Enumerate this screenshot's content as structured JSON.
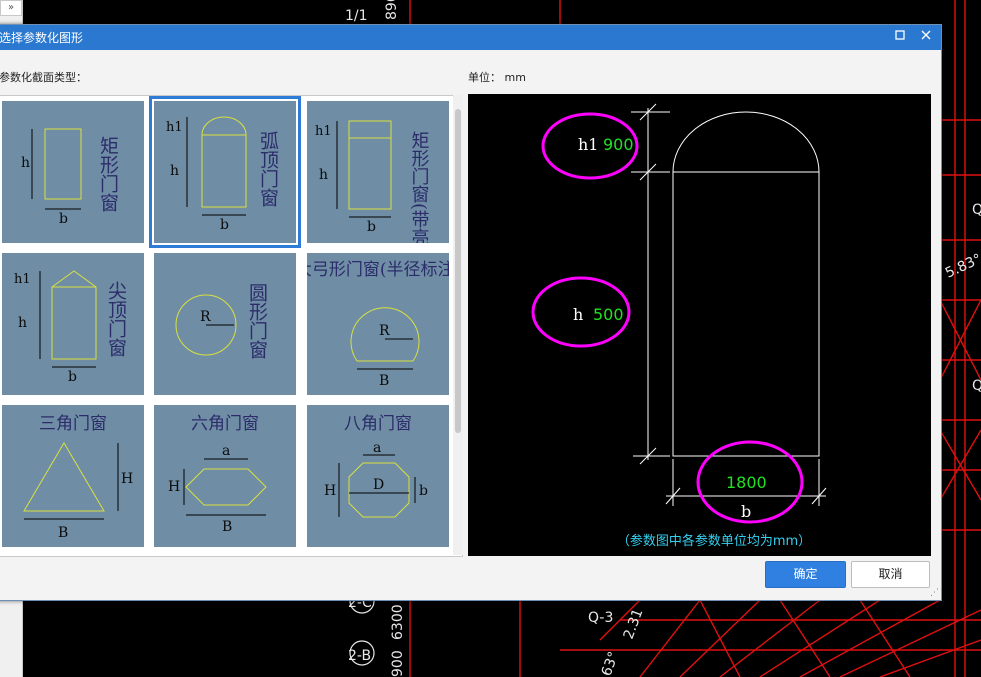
{
  "window": {
    "title": "选择参数化图形",
    "section_label": "参数化截面类型：",
    "unit_label": "单位：",
    "unit_value": "mm"
  },
  "shapes": [
    {
      "label": "矩形门窗",
      "dims": [
        "h",
        "b"
      ]
    },
    {
      "label": "弧顶门窗",
      "dims": [
        "h1",
        "h",
        "b"
      ],
      "selected": true
    },
    {
      "label": "矩形门窗(带亮子)",
      "dims": [
        "h1",
        "h",
        "b"
      ]
    },
    {
      "label": "尖顶门窗",
      "dims": [
        "h1",
        "h",
        "b"
      ]
    },
    {
      "label": "圆形门窗",
      "dims": [
        "R"
      ]
    },
    {
      "label": "大弓形门窗(半径标注)",
      "dims": [
        "R",
        "B"
      ]
    },
    {
      "label": "三角门窗",
      "dims": [
        "H",
        "B"
      ]
    },
    {
      "label": "六角门窗",
      "dims": [
        "a",
        "H",
        "B"
      ]
    },
    {
      "label": "八角门窗",
      "dims": [
        "a",
        "H",
        "D",
        "b"
      ]
    }
  ],
  "preview": {
    "params": [
      {
        "name": "h1",
        "value": "900"
      },
      {
        "name": "h",
        "value": "500"
      },
      {
        "name": "b",
        "value": "1800"
      }
    ],
    "note": "（参数图中各参数单位均为mm）"
  },
  "buttons": {
    "ok": "确定",
    "cancel": "取消"
  },
  "background_cad": {
    "labels": [
      "1/1",
      "890",
      "2-C",
      "2-B",
      "Q-3",
      "2.31",
      "63°",
      "5.83°",
      "Q",
      "Q",
      "900",
      "6300"
    ]
  },
  "colors": {
    "title_bar": "#2a78d0",
    "cell_bg": "#6f8ea5",
    "highlight_magenta": "#ff00ff",
    "value_green": "#22e022",
    "cad_red": "#ff1a1a"
  }
}
